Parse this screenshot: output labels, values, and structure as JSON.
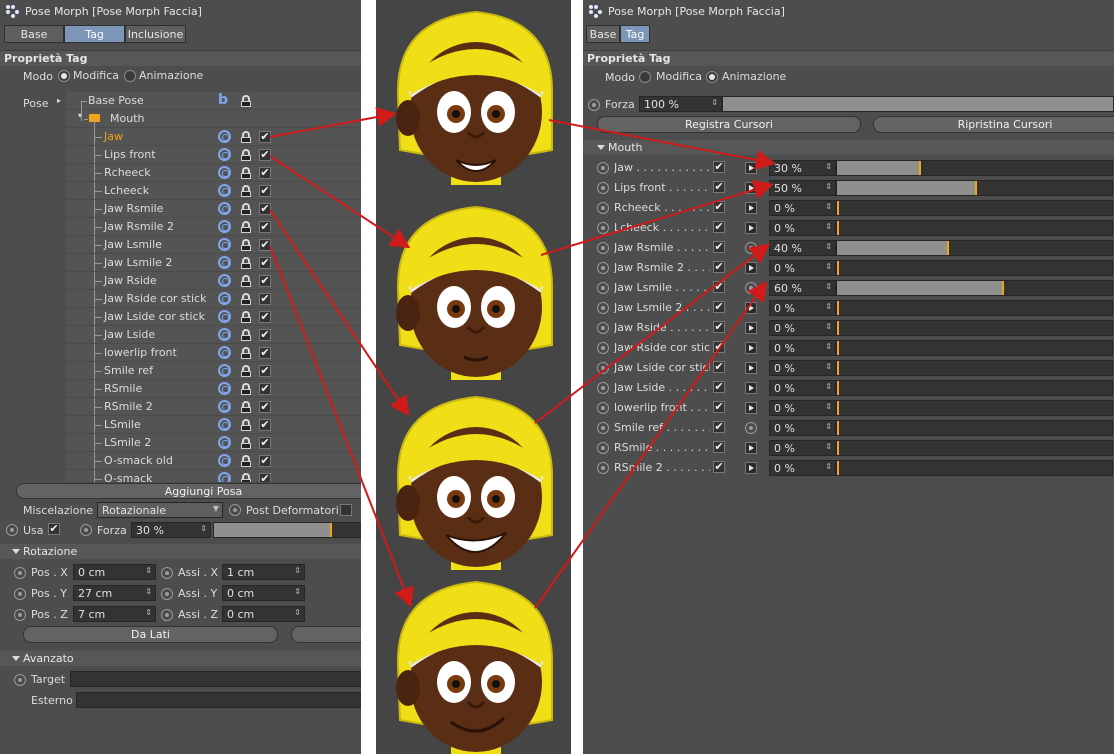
{
  "left": {
    "title": "Pose Morph",
    "title_bracket": "[Pose Morph Faccia]",
    "tabs": [
      {
        "label": "Base"
      },
      {
        "label": "Tag"
      },
      {
        "label": "Inclusione"
      }
    ],
    "section": "Proprietà Tag",
    "modo_label": "Modo",
    "modo_options": [
      "Modifica",
      "Animazione"
    ],
    "pose_label": "Pose",
    "base_pose": "Base Pose",
    "group": "Mouth",
    "poses": [
      "Jaw",
      "Lips front",
      "Rcheeck",
      "Lcheeck",
      "Jaw Rsmile",
      "Jaw Rsmile 2",
      "Jaw Lsmile",
      "Jaw Lsmile 2",
      "Jaw Rside",
      "Jaw Rside cor stick",
      "Jaw Lside cor stick",
      "Jaw Lside",
      "lowerlip front",
      "Smile ref",
      "RSmile",
      "RSmile 2",
      "LSmile",
      "LSmile 2",
      "O-smack old",
      "O-smack"
    ],
    "add_pose": "Aggiungi Posa",
    "miscelazione_label": "Miscelazione",
    "miscelazione_value": "Rotazionale",
    "post_deformatori": "Post Deformatori",
    "usa_label": "Usa",
    "forza_label": "Forza",
    "forza_value": "30 %",
    "forza_level": 0.3,
    "rotazione": "Rotazione",
    "pos_x_label": "Pos . X",
    "pos_x": "0 cm",
    "pos_y_label": "Pos . Y",
    "pos_y": "27 cm",
    "pos_z_label": "Pos . Z",
    "pos_z": "7 cm",
    "assi_x_label": "Assi . X",
    "assi_x": "1 cm",
    "assi_y_label": "Assi . Y",
    "assi_y": "0 cm",
    "assi_z_label": "Assi . Z",
    "assi_z": "0 cm",
    "da_lati": "Da Lati",
    "avanzato": "Avanzato",
    "target_label": "Target",
    "esterno_label": "Esterno"
  },
  "right": {
    "title": "Pose Morph",
    "title_bracket": "[Pose Morph Faccia]",
    "tabs": [
      {
        "label": "Base"
      },
      {
        "label": "Tag"
      }
    ],
    "section": "Proprietà Tag",
    "modo_label": "Modo",
    "modo_options": [
      "Modifica",
      "Animazione"
    ],
    "forza_label": "Forza",
    "forza_value": "100 %",
    "registra": "Registra Cursori",
    "ripristina": "Ripristina Cursori",
    "group": "Mouth",
    "rows": [
      {
        "name": "Jaw . . . . . . . . . . . . . .",
        "value": "30 %",
        "level": 0.3
      },
      {
        "name": "Lips front . . . . . . . . .",
        "value": "50 %",
        "level": 0.5
      },
      {
        "name": "Rcheeck . . . . . . . . . . .",
        "value": "0 %",
        "level": 0
      },
      {
        "name": "Lcheeck . . . . . . . . . . .",
        "value": "0 %",
        "level": 0
      },
      {
        "name": "Jaw Rsmile . . . . . . . .",
        "value": "40 %",
        "level": 0.4
      },
      {
        "name": "Jaw Rsmile 2 . . . . . .",
        "value": "0 %",
        "level": 0
      },
      {
        "name": "Jaw Lsmile . . . . . . . .",
        "value": "60 %",
        "level": 0.6
      },
      {
        "name": "Jaw Lsmile 2 . . . . . .",
        "value": "0 %",
        "level": 0
      },
      {
        "name": "Jaw Rside . . . . . . . . .",
        "value": "0 %",
        "level": 0
      },
      {
        "name": "Jaw Rside cor stick",
        "value": "0 %",
        "level": 0
      },
      {
        "name": "Jaw Lside cor stick",
        "value": "0 %",
        "level": 0
      },
      {
        "name": "Jaw Lside . . . . . . . . .",
        "value": "0 %",
        "level": 0
      },
      {
        "name": "lowerlip front . . . . .",
        "value": "0 %",
        "level": 0
      },
      {
        "name": "Smile ref . . . . . . . . .",
        "value": "0 %",
        "level": 0
      },
      {
        "name": "RSmile . . . . . . . . . . .",
        "value": "0 %",
        "level": 0
      },
      {
        "name": "RSmile 2 . . . . . . . . .",
        "value": "0 %",
        "level": 0
      }
    ]
  },
  "colors": {
    "accent": "#7d95b7",
    "arrow": "#d11a1a",
    "helmet": "#f0df17",
    "skin": "#5a2e14",
    "slider_mark": "#f3a418"
  }
}
